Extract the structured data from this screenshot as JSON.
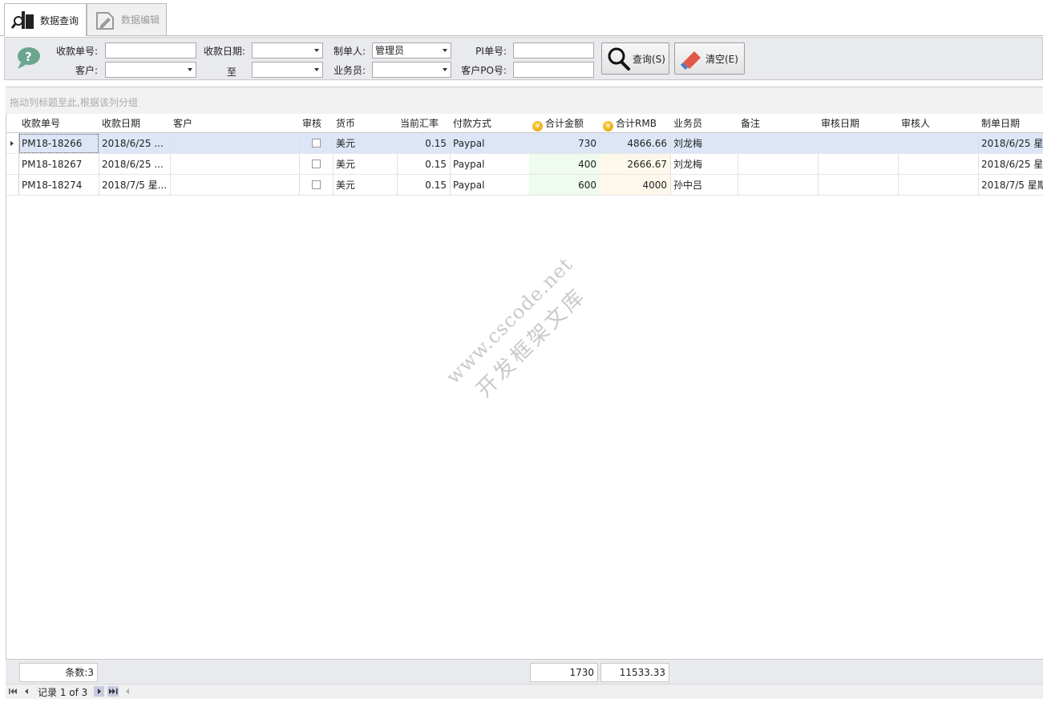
{
  "tabs": [
    {
      "label": "数据查询",
      "icon": "search-icon"
    },
    {
      "label": "数据编辑",
      "icon": "edit-icon"
    }
  ],
  "filter": {
    "receipt_no_label": "收款单号:",
    "receipt_date_label": "收款日期:",
    "creator_label": "制单人:",
    "creator_value": "管理员",
    "pi_label": "PI单号:",
    "customer_label": "客户:",
    "to_label": "至",
    "salesman_label": "业务员:",
    "customer_po_label": "客户PO号:",
    "query_button": "查询(S)",
    "clear_button": "清空(E)"
  },
  "group_hint": "拖动列标题至此,根据该列分组",
  "columns": [
    "收款单号",
    "收款日期",
    "客户",
    "审核",
    "货币",
    "当前汇率",
    "付款方式",
    "合计金额",
    "合计RMB",
    "业务员",
    "备注",
    "审核日期",
    "审核人",
    "制单日期"
  ],
  "rows": [
    {
      "no": "PM18-18266",
      "date": "2018/6/25 ...",
      "customer": "",
      "currency": "美元",
      "rate": "0.15",
      "payment": "Paypal",
      "amount": "730",
      "rmb": "4866.66",
      "salesman": "刘龙梅",
      "note": "",
      "audit_date": "",
      "auditor": "",
      "created": "2018/6/25 星..."
    },
    {
      "no": "PM18-18267",
      "date": "2018/6/25 ...",
      "customer": "",
      "currency": "美元",
      "rate": "0.15",
      "payment": "Paypal",
      "amount": "400",
      "rmb": "2666.67",
      "salesman": "刘龙梅",
      "note": "",
      "audit_date": "",
      "auditor": "",
      "created": "2018/6/25 星..."
    },
    {
      "no": "PM18-18274",
      "date": "2018/7/5 星...",
      "customer": "",
      "currency": "美元",
      "rate": "0.15",
      "payment": "Paypal",
      "amount": "600",
      "rmb": "4000",
      "salesman": "孙中吕",
      "note": "",
      "audit_date": "",
      "auditor": "",
      "created": "2018/7/5 星期"
    }
  ],
  "footer": {
    "count": "条数:3",
    "amount_total": "1730",
    "rmb_total": "11533.33"
  },
  "navigator": {
    "record_text": "记录 1 of 3"
  },
  "watermark": {
    "line1": "www.cscode.net",
    "line2": "开发框架文库"
  }
}
